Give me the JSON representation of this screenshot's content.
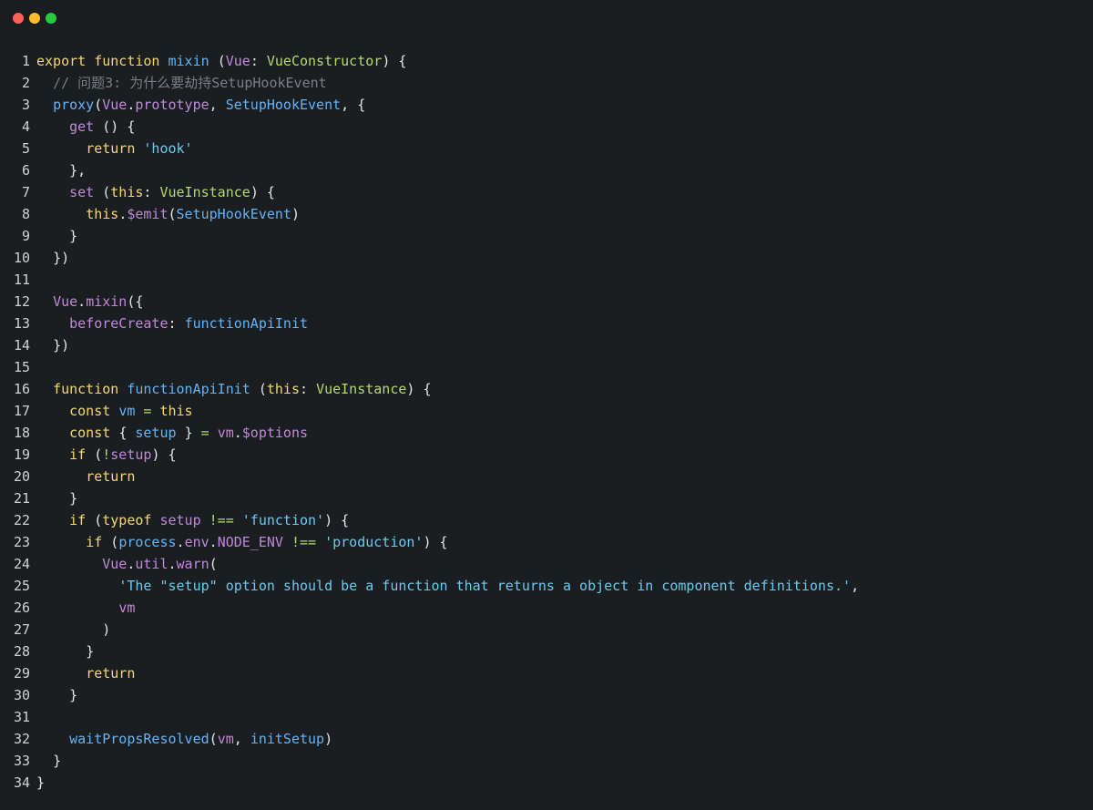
{
  "window": {
    "controls": [
      "close",
      "minimize",
      "zoom"
    ],
    "colors": {
      "close": "#ff5f56",
      "minimize": "#ffbd2e",
      "zoom": "#27c93f",
      "background": "#1b1e21"
    }
  },
  "code": {
    "language": "typescript",
    "lines": [
      [
        [
          "kw",
          "export "
        ],
        [
          "kw",
          "function "
        ],
        [
          "fn",
          "mixin "
        ],
        [
          "pu",
          "("
        ],
        [
          "vr",
          "Vue"
        ],
        [
          "pu",
          ": "
        ],
        [
          "ty",
          "VueConstructor"
        ],
        [
          "pu",
          ") {"
        ]
      ],
      [
        [
          "df",
          "  "
        ],
        [
          "cm",
          "// 问题3: 为什么要劫持SetupHookEvent"
        ]
      ],
      [
        [
          "df",
          "  "
        ],
        [
          "fn",
          "proxy"
        ],
        [
          "pu",
          "("
        ],
        [
          "vr",
          "Vue"
        ],
        [
          "pu",
          "."
        ],
        [
          "vr",
          "prototype"
        ],
        [
          "pu",
          ", "
        ],
        [
          "fn",
          "SetupHookEvent"
        ],
        [
          "pu",
          ", {"
        ]
      ],
      [
        [
          "df",
          "    "
        ],
        [
          "vr",
          "get "
        ],
        [
          "pu",
          "() {"
        ]
      ],
      [
        [
          "df",
          "      "
        ],
        [
          "kw",
          "return "
        ],
        [
          "st",
          "'hook'"
        ]
      ],
      [
        [
          "df",
          "    "
        ],
        [
          "pu",
          "},"
        ]
      ],
      [
        [
          "df",
          "    "
        ],
        [
          "vr",
          "set "
        ],
        [
          "pu",
          "("
        ],
        [
          "kw",
          "this"
        ],
        [
          "pu",
          ": "
        ],
        [
          "ty",
          "VueInstance"
        ],
        [
          "pu",
          ") {"
        ]
      ],
      [
        [
          "df",
          "      "
        ],
        [
          "kw",
          "this"
        ],
        [
          "pu",
          "."
        ],
        [
          "vr",
          "$emit"
        ],
        [
          "pu",
          "("
        ],
        [
          "fn",
          "SetupHookEvent"
        ],
        [
          "pu",
          ")"
        ]
      ],
      [
        [
          "df",
          "    "
        ],
        [
          "pu",
          "}"
        ]
      ],
      [
        [
          "df",
          "  "
        ],
        [
          "pu",
          "})"
        ]
      ],
      [],
      [
        [
          "df",
          "  "
        ],
        [
          "vr",
          "Vue"
        ],
        [
          "pu",
          "."
        ],
        [
          "vr",
          "mixin"
        ],
        [
          "pu",
          "({"
        ]
      ],
      [
        [
          "df",
          "    "
        ],
        [
          "vr",
          "beforeCreate"
        ],
        [
          "pu",
          ": "
        ],
        [
          "fn",
          "functionApiInit"
        ]
      ],
      [
        [
          "df",
          "  "
        ],
        [
          "pu",
          "})"
        ]
      ],
      [],
      [
        [
          "df",
          "  "
        ],
        [
          "kw",
          "function "
        ],
        [
          "fn",
          "functionApiInit "
        ],
        [
          "pu",
          "("
        ],
        [
          "kw",
          "this"
        ],
        [
          "pu",
          ": "
        ],
        [
          "ty",
          "VueInstance"
        ],
        [
          "pu",
          ") {"
        ]
      ],
      [
        [
          "df",
          "    "
        ],
        [
          "kw",
          "const "
        ],
        [
          "fn",
          "vm "
        ],
        [
          "op",
          "= "
        ],
        [
          "kw",
          "this"
        ]
      ],
      [
        [
          "df",
          "    "
        ],
        [
          "kw",
          "const "
        ],
        [
          "pu",
          "{ "
        ],
        [
          "fn",
          "setup "
        ],
        [
          "pu",
          "} "
        ],
        [
          "op",
          "= "
        ],
        [
          "vr",
          "vm"
        ],
        [
          "pu",
          "."
        ],
        [
          "vr",
          "$options"
        ]
      ],
      [
        [
          "df",
          "    "
        ],
        [
          "kw",
          "if "
        ],
        [
          "pu",
          "("
        ],
        [
          "op",
          "!"
        ],
        [
          "vr",
          "setup"
        ],
        [
          "pu",
          ") {"
        ]
      ],
      [
        [
          "df",
          "      "
        ],
        [
          "kw",
          "return"
        ]
      ],
      [
        [
          "df",
          "    "
        ],
        [
          "pu",
          "}"
        ]
      ],
      [
        [
          "df",
          "    "
        ],
        [
          "kw",
          "if "
        ],
        [
          "pu",
          "("
        ],
        [
          "kw",
          "typeof "
        ],
        [
          "vr",
          "setup "
        ],
        [
          "op",
          "!== "
        ],
        [
          "st",
          "'function'"
        ],
        [
          "pu",
          ") {"
        ]
      ],
      [
        [
          "df",
          "      "
        ],
        [
          "kw",
          "if "
        ],
        [
          "pu",
          "("
        ],
        [
          "fn",
          "process"
        ],
        [
          "pu",
          "."
        ],
        [
          "vr",
          "env"
        ],
        [
          "pu",
          "."
        ],
        [
          "vr",
          "NODE_ENV "
        ],
        [
          "op",
          "!== "
        ],
        [
          "st",
          "'production'"
        ],
        [
          "pu",
          ") {"
        ]
      ],
      [
        [
          "df",
          "        "
        ],
        [
          "vr",
          "Vue"
        ],
        [
          "pu",
          "."
        ],
        [
          "vr",
          "util"
        ],
        [
          "pu",
          "."
        ],
        [
          "vr",
          "warn"
        ],
        [
          "pu",
          "("
        ]
      ],
      [
        [
          "df",
          "          "
        ],
        [
          "st",
          "'The \"setup\" option should be a function that returns a object in component definitions.'"
        ],
        [
          "pu",
          ","
        ]
      ],
      [
        [
          "df",
          "          "
        ],
        [
          "vr",
          "vm"
        ]
      ],
      [
        [
          "df",
          "        "
        ],
        [
          "pu",
          ")"
        ]
      ],
      [
        [
          "df",
          "      "
        ],
        [
          "pu",
          "}"
        ]
      ],
      [
        [
          "df",
          "      "
        ],
        [
          "kw",
          "return"
        ]
      ],
      [
        [
          "df",
          "    "
        ],
        [
          "pu",
          "}"
        ]
      ],
      [],
      [
        [
          "df",
          "    "
        ],
        [
          "fn",
          "waitPropsResolved"
        ],
        [
          "pu",
          "("
        ],
        [
          "vr",
          "vm"
        ],
        [
          "pu",
          ", "
        ],
        [
          "fn",
          "initSetup"
        ],
        [
          "pu",
          ")"
        ]
      ],
      [
        [
          "df",
          "  "
        ],
        [
          "pu",
          "}"
        ]
      ],
      [
        [
          "pu",
          "}"
        ]
      ]
    ]
  }
}
